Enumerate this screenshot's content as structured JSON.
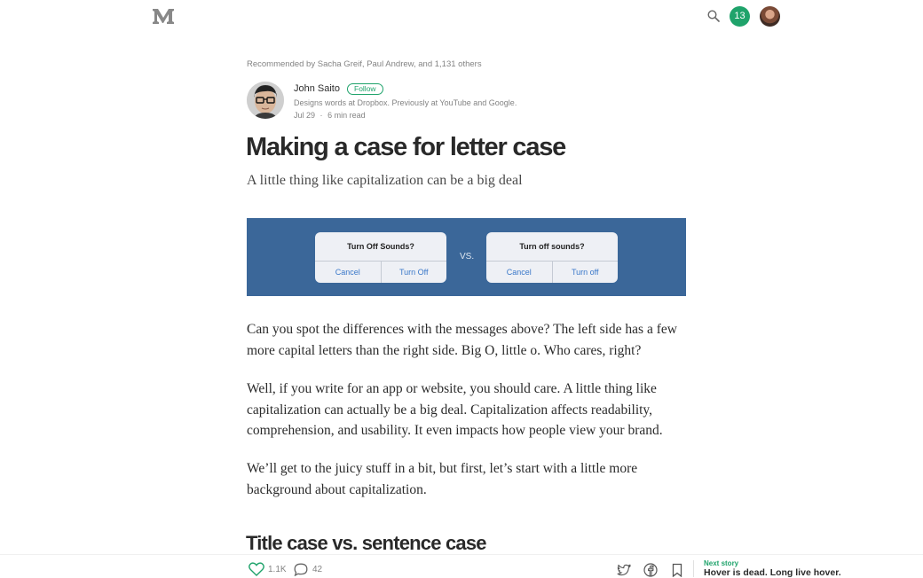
{
  "topbar": {
    "logo_icon": "medium-m-logo-icon",
    "search_icon": "search-icon",
    "notification_count": "13",
    "accent_color": "#1fa36b"
  },
  "article": {
    "recommended": "Recommended by Sacha Greif, Paul Andrew, and 1,131 others",
    "author": {
      "name": "John Saito",
      "follow_label": "Follow",
      "bio": "Designs words at Dropbox. Previously at YouTube and Google.",
      "date": "Jul 29",
      "separator": "·",
      "read_time": "6 min read"
    },
    "title": "Making a case for letter case",
    "subtitle": "A little thing like capitalization can be a big deal",
    "hero": {
      "background": "#3b6799",
      "left_dialog": {
        "title": "Turn Off Sounds?",
        "cancel": "Cancel",
        "confirm": "Turn Off"
      },
      "vs": "VS.",
      "right_dialog": {
        "title": "Turn off sounds?",
        "cancel": "Cancel",
        "confirm": "Turn off"
      }
    },
    "paragraphs": [
      "Can you spot the differences with the messages above? The left side has a few more capital letters than the right side. Big O, little o. Who cares, right?",
      "Well, if you write for an app or website, you should care. A little thing like capitalization can actually be a big deal. Capitalization affects readability, comprehension, and usability. It even impacts how people view your brand.",
      "We’ll get to the juicy stuff in a bit, but first, let’s start with a little more background about capitalization."
    ],
    "section_heading": "Title case vs. sentence case"
  },
  "bottombar": {
    "clap_count": "1.1K",
    "response_count": "42",
    "icons": [
      "heart-icon",
      "comment-icon",
      "twitter-icon",
      "facebook-icon",
      "bookmark-icon"
    ],
    "next_story_label": "Next story",
    "next_story_title": "Hover is dead. Long live hover."
  }
}
